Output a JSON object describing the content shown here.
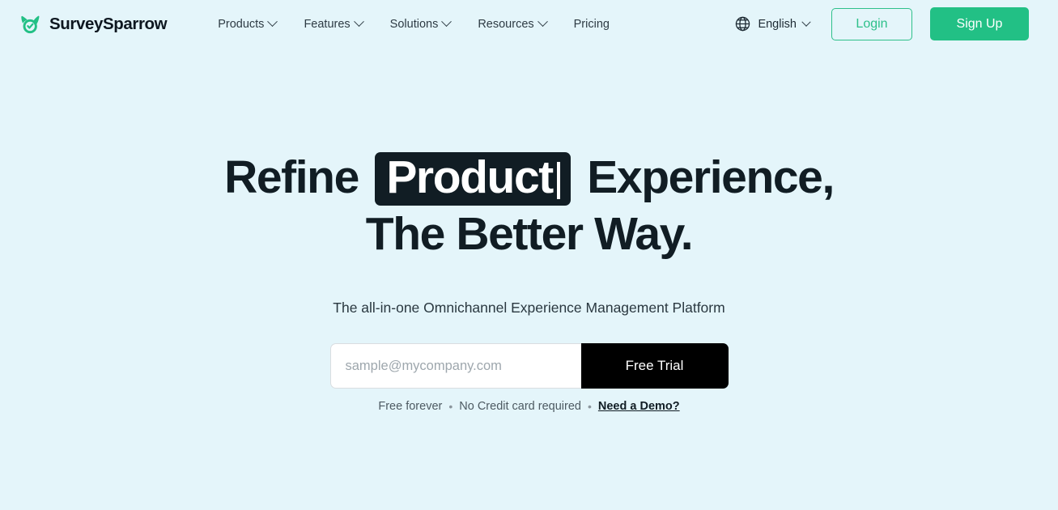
{
  "header": {
    "brand": {
      "name": "SurveySparrow",
      "logo_icon": "sparrow-check-logo",
      "logo_color": "#22c085"
    },
    "nav": [
      {
        "label": "Products",
        "has_dropdown": true
      },
      {
        "label": "Features",
        "has_dropdown": true
      },
      {
        "label": "Solutions",
        "has_dropdown": true
      },
      {
        "label": "Resources",
        "has_dropdown": true
      },
      {
        "label": "Pricing",
        "has_dropdown": false
      }
    ],
    "language": {
      "icon": "globe-icon",
      "label": "English",
      "has_dropdown": true
    },
    "login_label": "Login",
    "signup_label": "Sign Up"
  },
  "hero": {
    "headline_part1": "Refine",
    "headline_highlight": "Product",
    "headline_part2": "Experience,",
    "headline_line2": "The Better Way.",
    "subheadline": "The all-in-one Omnichannel Experience Management Platform",
    "email_placeholder": "sample@mycompany.com",
    "email_value": "",
    "trial_label": "Free Trial",
    "note_free": "Free forever",
    "note_sep1": "•",
    "note_credit": "No Credit card required",
    "note_sep2": "•",
    "note_demo": "Need a Demo?"
  },
  "colors": {
    "page_background": "#e4f5fa",
    "brand_green": "#22c085",
    "ink": "#111d24",
    "cta_black": "#000000"
  }
}
